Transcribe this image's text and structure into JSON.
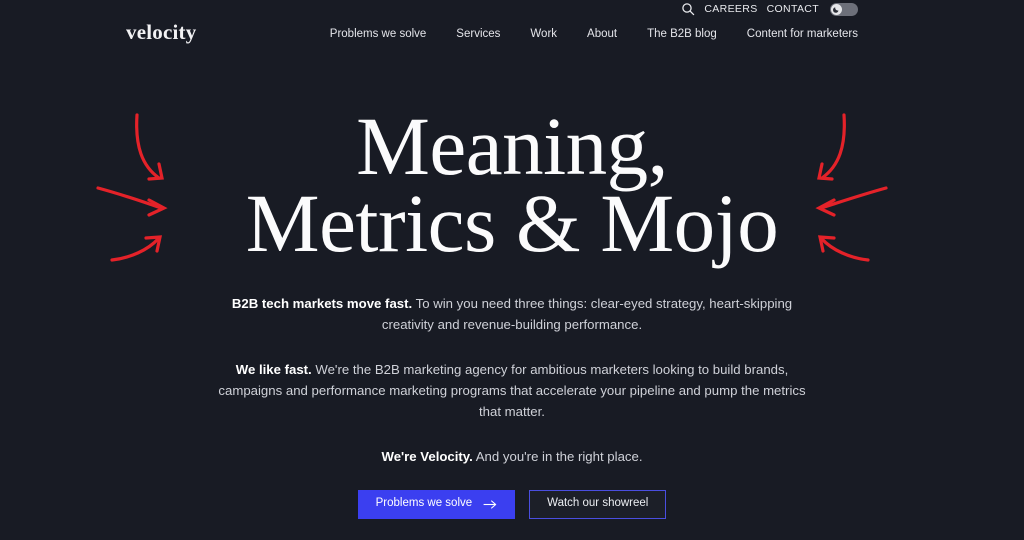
{
  "theme": {
    "background": "#181b24",
    "accent_blue": "#3b3ff0",
    "accent_red": "#e42229",
    "text_primary": "#fbfbfc",
    "text_body": "#cfd1d8"
  },
  "utility_bar": {
    "search_icon": "search-icon",
    "links": [
      {
        "label": "CAREERS"
      },
      {
        "label": "CONTACT"
      }
    ],
    "theme_toggle": {
      "icon": "moon-icon",
      "state": "dark"
    }
  },
  "header": {
    "brand": "velocity",
    "nav": [
      {
        "label": "Problems we solve"
      },
      {
        "label": "Services"
      },
      {
        "label": "Work"
      },
      {
        "label": "About"
      },
      {
        "label": "The B2B blog"
      },
      {
        "label": "Content for marketers"
      }
    ]
  },
  "hero": {
    "title_line_1": "Meaning,",
    "title_line_2": "Metrics & Mojo",
    "paragraphs": [
      {
        "lead": "B2B tech markets move fast.",
        "rest": " To win you need three things: clear-eyed strategy, heart-skipping creativity and revenue-building performance."
      },
      {
        "lead": "We like fast.",
        "rest": " We're the B2B marketing agency for ambitious marketers looking to build brands, campaigns and performance marketing programs that accelerate your pipeline and pump the metrics that matter."
      },
      {
        "lead": "We're Velocity.",
        "rest": " And you're in the right place."
      }
    ],
    "cta": {
      "primary": {
        "label": "Problems we solve",
        "icon": "arrow-right-icon"
      },
      "secondary": {
        "label": "Watch our showreel"
      }
    },
    "decorations": {
      "left": "three-red-arrows-pointing-right",
      "right": "three-red-arrows-pointing-left"
    }
  }
}
